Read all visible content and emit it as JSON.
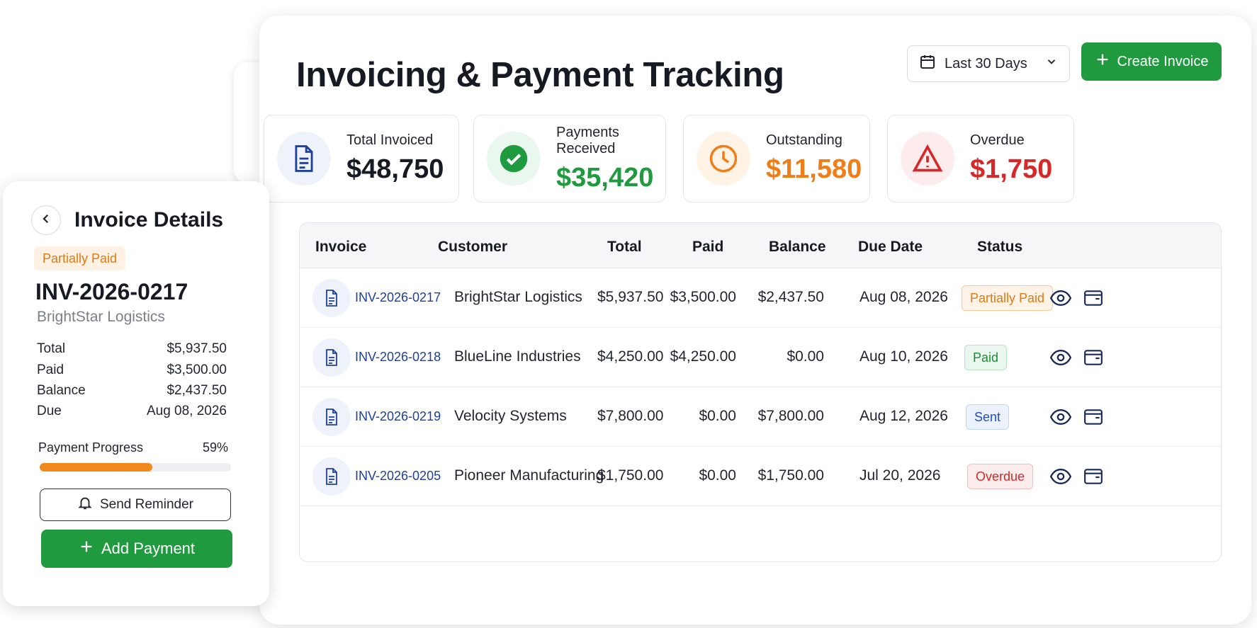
{
  "header": {
    "title": "Invoicing & Payment Tracking",
    "date_range": "Last 30 Days",
    "create_label": "Create Invoice"
  },
  "stats": [
    {
      "label": "Total Invoiced",
      "value": "$48,750",
      "color": "#161a22"
    },
    {
      "label": "Payments Received",
      "value": "$35,420",
      "color": "#1f9a3e"
    },
    {
      "label": "Outstanding",
      "value": "$11,580",
      "color": "#f07e16"
    },
    {
      "label": "Overdue",
      "value": "$1,750",
      "color": "#d62828"
    }
  ],
  "table": {
    "columns": [
      "Invoice",
      "Customer",
      "Total",
      "Paid",
      "Balance",
      "Due Date",
      "Status"
    ],
    "rows": [
      {
        "invoice": "INV-2026-0217",
        "customer": "BrightStar Logistics",
        "total": "$5,937.50",
        "paid": "$3,500.00",
        "balance": "$2,437.50",
        "due": "Aug 08, 2026",
        "status": "Partially Paid"
      },
      {
        "invoice": "INV-2026-0218",
        "customer": "BlueLine Industries",
        "total": "$4,250.00",
        "paid": "$4,250.00",
        "balance": "$0.00",
        "due": "Aug 10, 2026",
        "status": "Paid"
      },
      {
        "invoice": "INV-2026-0219",
        "customer": "Velocity Systems",
        "total": "$7,800.00",
        "paid": "$0.00",
        "balance": "$7,800.00",
        "due": "Aug 12, 2026",
        "status": "Sent"
      },
      {
        "invoice": "INV-2026-0205",
        "customer": "Pioneer Manufacturing",
        "total": "$1,750.00",
        "paid": "$0.00",
        "balance": "$1,750.00",
        "due": "Jul 20, 2026",
        "status": "Overdue"
      }
    ]
  },
  "status_colors": {
    "Partially Paid": {
      "fg": "#e07a12",
      "bg": "#fff3e8",
      "border": "#f6c99a"
    },
    "Paid": {
      "fg": "#1f8a3a",
      "bg": "#eaf7ee",
      "border": "#b9e2c5"
    },
    "Sent": {
      "fg": "#1e4fb8",
      "bg": "#ecf2fc",
      "border": "#c3d4f2"
    },
    "Overdue": {
      "fg": "#d62828",
      "bg": "#fdecec",
      "border": "#f2bcbc"
    }
  },
  "detail": {
    "title": "Invoice Details",
    "status": "Partially Paid",
    "invoice": "INV-2026-0217",
    "customer": "BrightStar Logistics",
    "fields": [
      {
        "label": "Total",
        "value": "$5,937.50"
      },
      {
        "label": "Paid",
        "value": "$3,500.00"
      },
      {
        "label": "Balance",
        "value": "$2,437.50"
      },
      {
        "label": "Due",
        "value": "Aug 08, 2026"
      }
    ],
    "progress_label": "Payment Progress",
    "progress_text": "59%",
    "progress_value": 0.59,
    "reminder_label": "Send Reminder",
    "add_payment_label": "Add Payment"
  }
}
